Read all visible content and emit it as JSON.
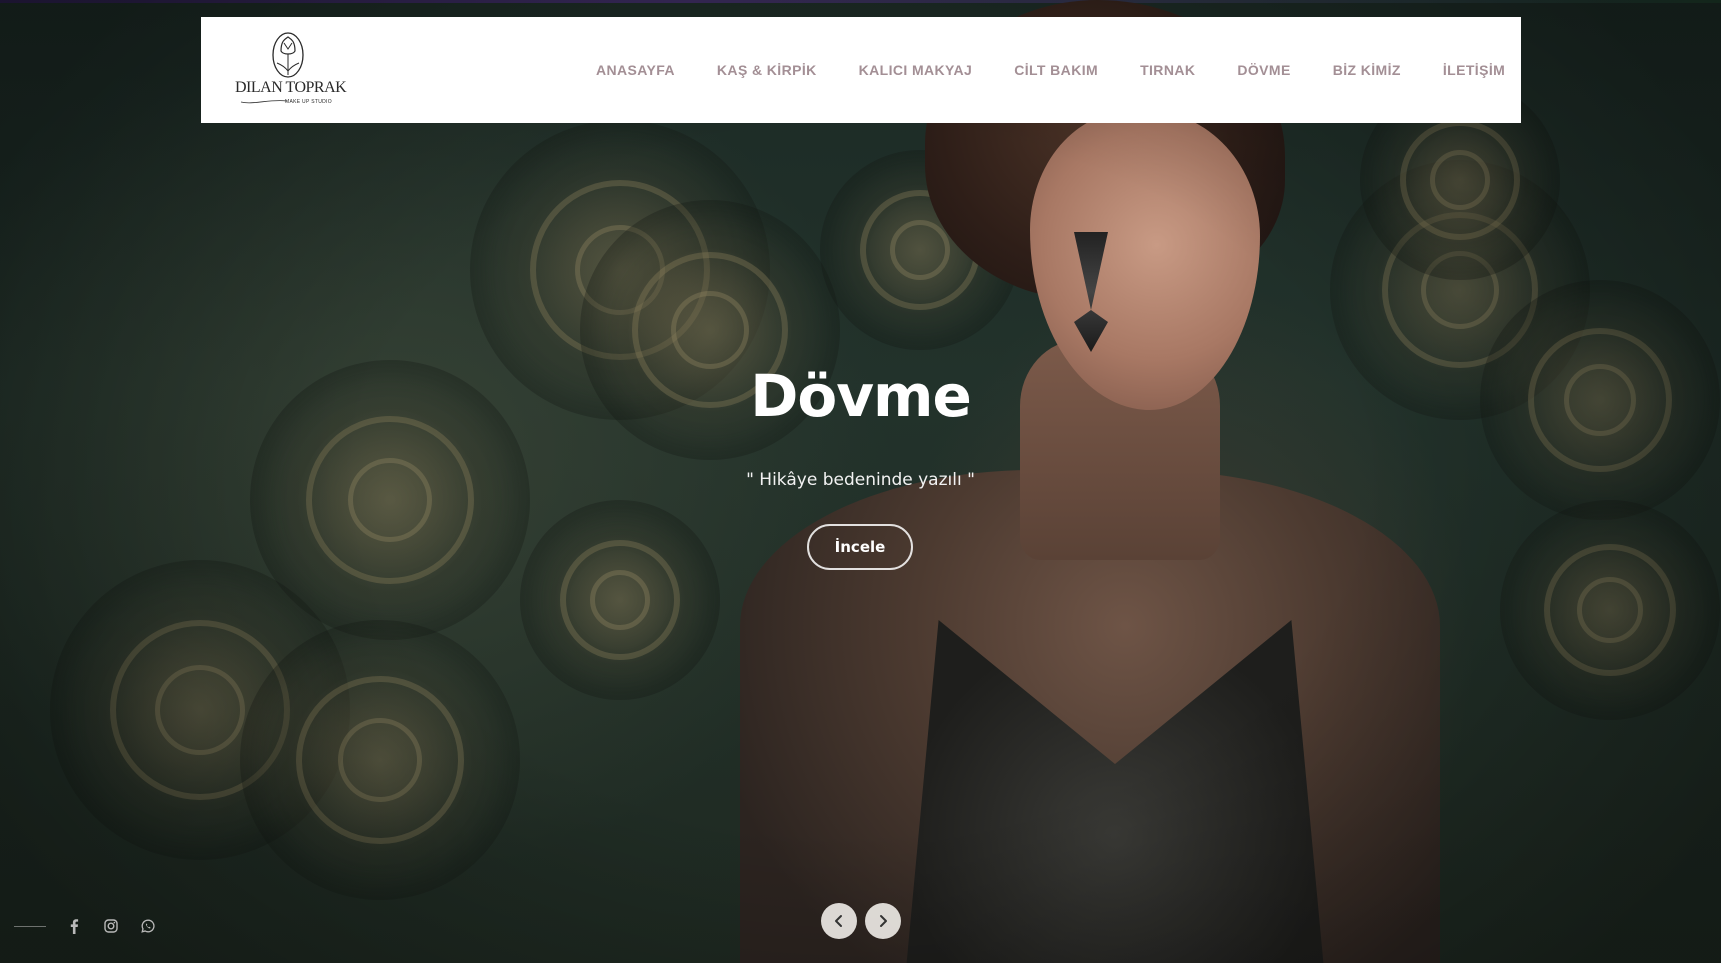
{
  "brand": {
    "name": "DILAN TOPRAK",
    "subtitle": "MAKE UP STUDIO",
    "logo_icon": "tulip-logo-icon"
  },
  "nav": {
    "items": [
      {
        "label": "ANASAYFA"
      },
      {
        "label": "KAŞ & KİRPİK"
      },
      {
        "label": "KALICI MAKYAJ"
      },
      {
        "label": "CİLT BAKIM"
      },
      {
        "label": "TIRNAK"
      },
      {
        "label": "DÖVME"
      },
      {
        "label": "BİZ KİMİZ"
      },
      {
        "label": "İLETİŞİM"
      }
    ],
    "color": "#a38f95"
  },
  "hero": {
    "title": "Dövme",
    "subtitle": "\" Hikâye bedeninde yazılı \"",
    "button_label": "İncele"
  },
  "slider": {
    "prev_icon": "chevron-left-icon",
    "next_icon": "chevron-right-icon"
  },
  "social": {
    "icons": [
      "facebook-icon",
      "instagram-icon",
      "whatsapp-icon"
    ]
  },
  "colors": {
    "background": "#22322b",
    "header_bg": "#ffffff",
    "hero_text": "#ffffff"
  }
}
